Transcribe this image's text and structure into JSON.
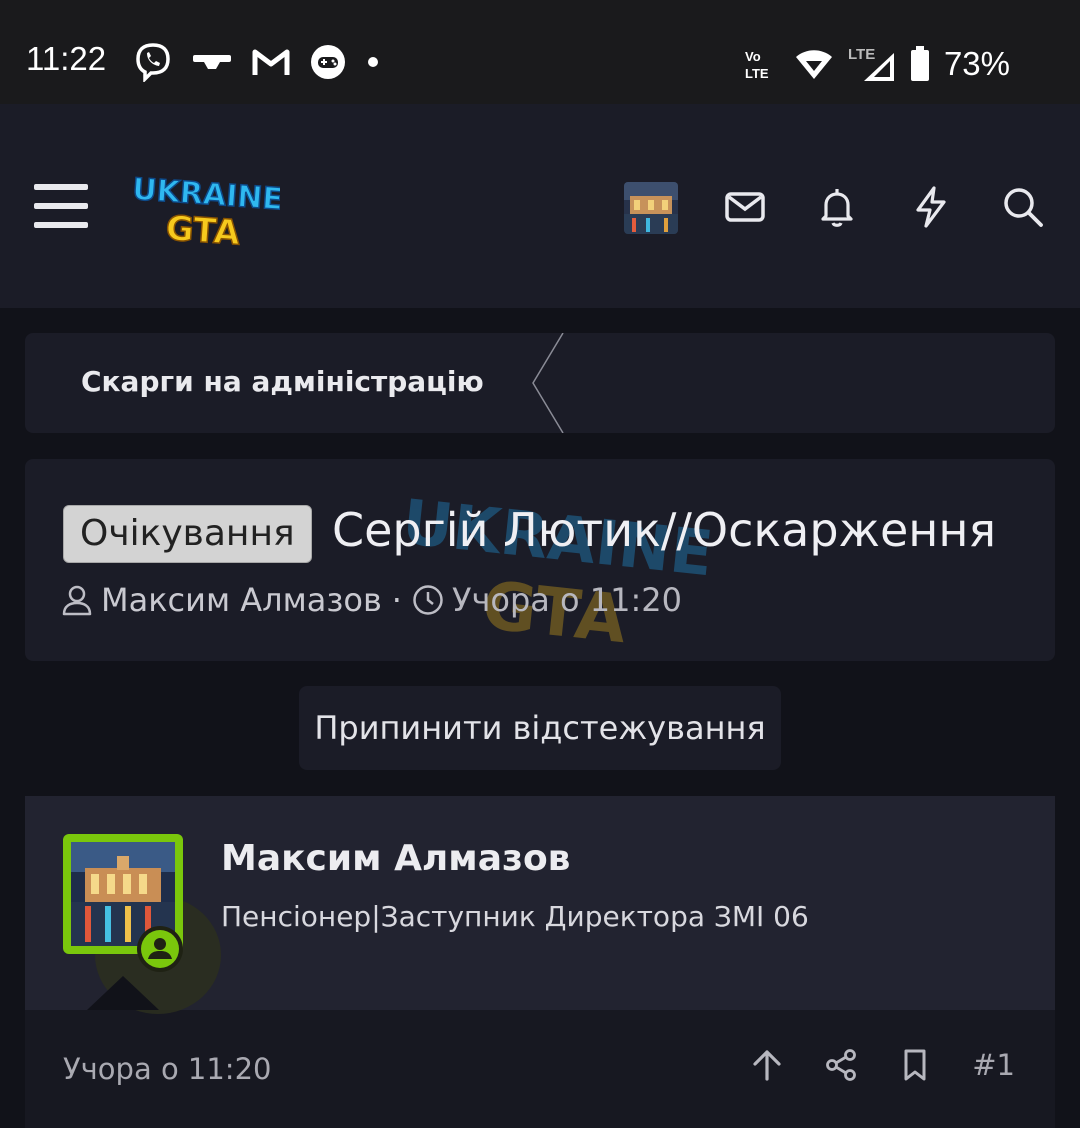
{
  "status_bar": {
    "time": "11:22",
    "battery": "73%",
    "left_icons": [
      "viber-icon",
      "drone-icon",
      "gmail-icon",
      "game-controller-icon",
      "dot-icon"
    ],
    "right_icons": [
      "volte-icon",
      "wifi-icon",
      "lte-signal-icon",
      "battery-icon"
    ],
    "volte_label": "Vo LTE",
    "lte_label": "LTE"
  },
  "header": {
    "menu_icon": "hamburger-icon",
    "logo_text_1": "UKRAINE",
    "logo_text_2": "GTA",
    "icons": [
      "avatar",
      "mail-icon",
      "bell-icon",
      "lightning-icon",
      "search-icon"
    ]
  },
  "breadcrumb": {
    "label": "Скарги на адміністрацію"
  },
  "thread": {
    "prefix": "Очікування",
    "title": "Сергій Лютик//Оскарження",
    "author": "Максим Алмазов",
    "separator": "·",
    "date": "Учора о 11:20"
  },
  "unwatch_button": "Припинити відстежування",
  "post": {
    "author": "Максим Алмазов",
    "role": "Пенсіонер|Заступник Директора ЗМІ 06",
    "date": "Учора о 11:20",
    "number": "#1"
  },
  "colors": {
    "background": "#111219",
    "panel": "#1b1c27",
    "avatar_border": "#7ac70c",
    "badge": "#d3d3d3"
  }
}
